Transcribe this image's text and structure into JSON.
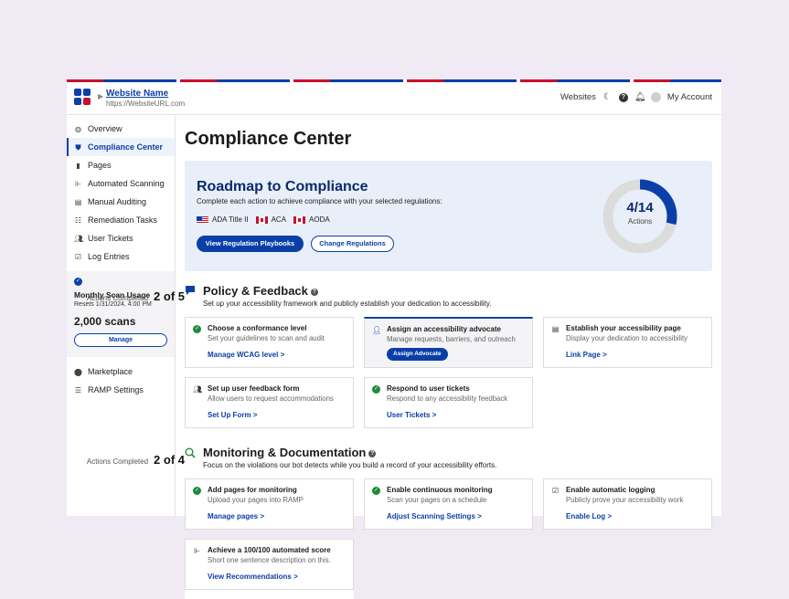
{
  "header": {
    "site_name": "Website Name",
    "site_url": "https://WebsiteURL.com",
    "websites_label": "Websites",
    "account_label": "My Account",
    "icons": [
      "moon-icon",
      "help-icon",
      "bell-icon",
      "avatar-icon"
    ]
  },
  "sidebar": {
    "items": [
      {
        "label": "Overview",
        "icon": "dashboard-icon"
      },
      {
        "label": "Compliance Center",
        "icon": "shield-icon",
        "active": true
      },
      {
        "label": "Pages",
        "icon": "file-icon"
      },
      {
        "label": "Automated Scanning",
        "icon": "scan-icon"
      },
      {
        "label": "Manual Auditing",
        "icon": "clipboard-icon"
      },
      {
        "label": "Remediation Tasks",
        "icon": "list-icon"
      },
      {
        "label": "User Tickets",
        "icon": "users-icon"
      },
      {
        "label": "Log Entries",
        "icon": "log-icon"
      }
    ],
    "usage": {
      "title": "Monthly Scan Usage",
      "resets": "Resets 1/31/2024, 4:00 PM",
      "count": "2,000 scans",
      "button": "Manage"
    },
    "bottom_items": [
      {
        "label": "Marketplace",
        "icon": "marketplace-icon"
      },
      {
        "label": "RAMP Settings",
        "icon": "settings-icon"
      }
    ]
  },
  "main": {
    "title": "Compliance Center",
    "roadmap": {
      "title": "Roadmap to Compliance",
      "subtitle": "Complete each action to achieve compliance with your selected regulations:",
      "regulations": [
        {
          "label": "ADA Title II",
          "flag": "us-flag"
        },
        {
          "label": "ACA",
          "flag": "canada-flag"
        },
        {
          "label": "AODA",
          "flag": "canada-flag"
        }
      ],
      "primary_button": "View Regulation Playbooks",
      "secondary_button": "Change Regulations",
      "progress": {
        "text": "4/14",
        "label": "Actions",
        "completed": 4,
        "total": 14
      }
    },
    "policy": {
      "title": "Policy & Feedback",
      "subtitle": "Set up your accessibility framework and publicly establish your dedication to accessibility.",
      "actions_label": "Actions Completed",
      "actions_value": "2 of 5",
      "cards": [
        {
          "title": "Choose a conformance level",
          "desc": "Set your guidelines to scan and audit",
          "link": "Manage WCAG level >",
          "status": "done"
        },
        {
          "title": "Assign an accessibility advocate",
          "desc": "Manage requests, barriers, and outreach",
          "button": "Assign Advocate",
          "status": "todo",
          "icon": "person-icon"
        },
        {
          "title": "Establish your accessibility page",
          "desc": "Display your dedication to accessibility",
          "link": "Link Page >",
          "status": "todo",
          "icon": "chat-icon"
        },
        {
          "title": "Set up user feedback form",
          "desc": "Allow users to request accommodations",
          "link": "Set Up Form >",
          "status": "todo",
          "icon": "users-icon"
        },
        {
          "title": "Respond to user tickets",
          "desc": "Respond to any accessibility feedback",
          "link": "User Tickets >",
          "status": "done"
        }
      ]
    },
    "monitoring": {
      "title": "Monitoring & Documentation",
      "subtitle": "Focus on the violations our bot detects while you build a record of your accessibility efforts.",
      "actions_label": "Actions Completed",
      "actions_value": "2 of 4",
      "cards": [
        {
          "title": "Add pages for monitoring",
          "desc": "Upload your pages into RAMP",
          "link": "Manage pages >",
          "status": "done"
        },
        {
          "title": "Enable continuous monitoring",
          "desc": "Scan your pages on a schedule",
          "link": "Adjust Scanning Settings >",
          "status": "done"
        },
        {
          "title": "Enable automatic logging",
          "desc": "Publicly prove your accessibility work",
          "link": "Enable Log >",
          "status": "todo",
          "icon": "log-icon"
        },
        {
          "title": "Achieve a 100/100 automated score",
          "desc": "Short one sentence description on this.",
          "link": "View Recommendations >",
          "status": "todo",
          "icon": "scan-icon"
        }
      ]
    }
  },
  "colors": {
    "brand": "#0b3fa8",
    "success": "#1e8a3c",
    "roadmap_bg": "#e9eff9",
    "page_bg": "#efeaf4"
  }
}
